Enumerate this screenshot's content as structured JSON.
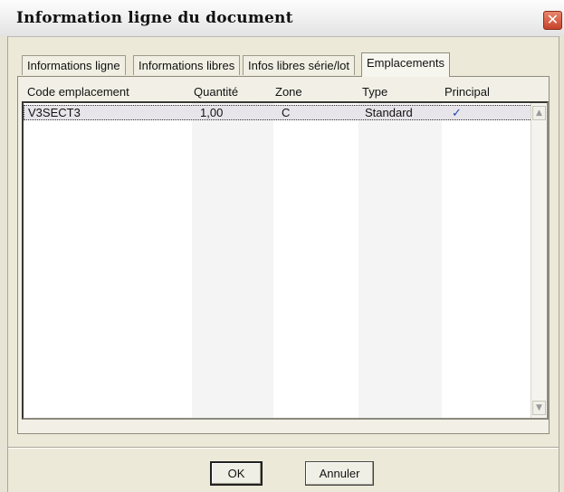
{
  "window": {
    "title": "Information ligne du document",
    "close_glyph": "✕"
  },
  "tabs": [
    {
      "label": "Informations ligne",
      "active": false
    },
    {
      "label": "Informations libres",
      "active": false
    },
    {
      "label": "Infos libres série/lot",
      "active": false
    },
    {
      "label": "Emplacements",
      "active": true
    }
  ],
  "list": {
    "columns": [
      "Code emplacement",
      "Quantité",
      "Zone",
      "Type",
      "Principal"
    ],
    "rows": [
      {
        "code": "V3SECT3",
        "quantite": "1,00",
        "zone": "C",
        "type": "Standard",
        "principal": "✓",
        "principal_checked": true
      }
    ]
  },
  "scrollbar": {
    "up_glyph": "▲",
    "down_glyph": "▼"
  },
  "buttons": {
    "ok": "OK",
    "cancel": "Annuler"
  }
}
